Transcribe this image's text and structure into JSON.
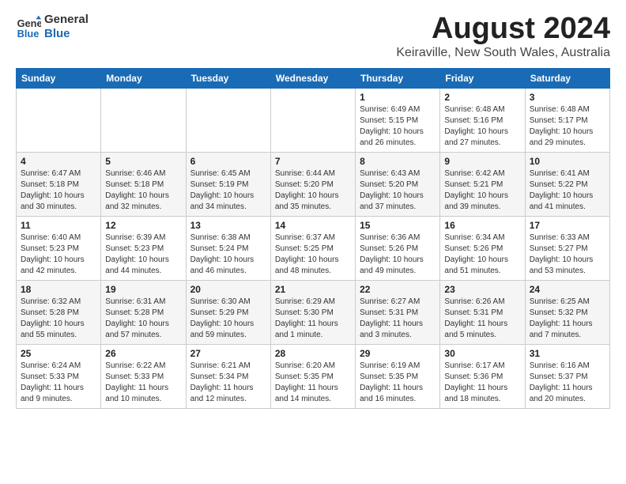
{
  "logo": {
    "line1": "General",
    "line2": "Blue"
  },
  "title": {
    "month_year": "August 2024",
    "location": "Keiraville, New South Wales, Australia"
  },
  "weekdays": [
    "Sunday",
    "Monday",
    "Tuesday",
    "Wednesday",
    "Thursday",
    "Friday",
    "Saturday"
  ],
  "weeks": [
    [
      {
        "day": "",
        "info": ""
      },
      {
        "day": "",
        "info": ""
      },
      {
        "day": "",
        "info": ""
      },
      {
        "day": "",
        "info": ""
      },
      {
        "day": "1",
        "info": "Sunrise: 6:49 AM\nSunset: 5:15 PM\nDaylight: 10 hours\nand 26 minutes."
      },
      {
        "day": "2",
        "info": "Sunrise: 6:48 AM\nSunset: 5:16 PM\nDaylight: 10 hours\nand 27 minutes."
      },
      {
        "day": "3",
        "info": "Sunrise: 6:48 AM\nSunset: 5:17 PM\nDaylight: 10 hours\nand 29 minutes."
      }
    ],
    [
      {
        "day": "4",
        "info": "Sunrise: 6:47 AM\nSunset: 5:18 PM\nDaylight: 10 hours\nand 30 minutes."
      },
      {
        "day": "5",
        "info": "Sunrise: 6:46 AM\nSunset: 5:18 PM\nDaylight: 10 hours\nand 32 minutes."
      },
      {
        "day": "6",
        "info": "Sunrise: 6:45 AM\nSunset: 5:19 PM\nDaylight: 10 hours\nand 34 minutes."
      },
      {
        "day": "7",
        "info": "Sunrise: 6:44 AM\nSunset: 5:20 PM\nDaylight: 10 hours\nand 35 minutes."
      },
      {
        "day": "8",
        "info": "Sunrise: 6:43 AM\nSunset: 5:20 PM\nDaylight: 10 hours\nand 37 minutes."
      },
      {
        "day": "9",
        "info": "Sunrise: 6:42 AM\nSunset: 5:21 PM\nDaylight: 10 hours\nand 39 minutes."
      },
      {
        "day": "10",
        "info": "Sunrise: 6:41 AM\nSunset: 5:22 PM\nDaylight: 10 hours\nand 41 minutes."
      }
    ],
    [
      {
        "day": "11",
        "info": "Sunrise: 6:40 AM\nSunset: 5:23 PM\nDaylight: 10 hours\nand 42 minutes."
      },
      {
        "day": "12",
        "info": "Sunrise: 6:39 AM\nSunset: 5:23 PM\nDaylight: 10 hours\nand 44 minutes."
      },
      {
        "day": "13",
        "info": "Sunrise: 6:38 AM\nSunset: 5:24 PM\nDaylight: 10 hours\nand 46 minutes."
      },
      {
        "day": "14",
        "info": "Sunrise: 6:37 AM\nSunset: 5:25 PM\nDaylight: 10 hours\nand 48 minutes."
      },
      {
        "day": "15",
        "info": "Sunrise: 6:36 AM\nSunset: 5:26 PM\nDaylight: 10 hours\nand 49 minutes."
      },
      {
        "day": "16",
        "info": "Sunrise: 6:34 AM\nSunset: 5:26 PM\nDaylight: 10 hours\nand 51 minutes."
      },
      {
        "day": "17",
        "info": "Sunrise: 6:33 AM\nSunset: 5:27 PM\nDaylight: 10 hours\nand 53 minutes."
      }
    ],
    [
      {
        "day": "18",
        "info": "Sunrise: 6:32 AM\nSunset: 5:28 PM\nDaylight: 10 hours\nand 55 minutes."
      },
      {
        "day": "19",
        "info": "Sunrise: 6:31 AM\nSunset: 5:28 PM\nDaylight: 10 hours\nand 57 minutes."
      },
      {
        "day": "20",
        "info": "Sunrise: 6:30 AM\nSunset: 5:29 PM\nDaylight: 10 hours\nand 59 minutes."
      },
      {
        "day": "21",
        "info": "Sunrise: 6:29 AM\nSunset: 5:30 PM\nDaylight: 11 hours\nand 1 minute."
      },
      {
        "day": "22",
        "info": "Sunrise: 6:27 AM\nSunset: 5:31 PM\nDaylight: 11 hours\nand 3 minutes."
      },
      {
        "day": "23",
        "info": "Sunrise: 6:26 AM\nSunset: 5:31 PM\nDaylight: 11 hours\nand 5 minutes."
      },
      {
        "day": "24",
        "info": "Sunrise: 6:25 AM\nSunset: 5:32 PM\nDaylight: 11 hours\nand 7 minutes."
      }
    ],
    [
      {
        "day": "25",
        "info": "Sunrise: 6:24 AM\nSunset: 5:33 PM\nDaylight: 11 hours\nand 9 minutes."
      },
      {
        "day": "26",
        "info": "Sunrise: 6:22 AM\nSunset: 5:33 PM\nDaylight: 11 hours\nand 10 minutes."
      },
      {
        "day": "27",
        "info": "Sunrise: 6:21 AM\nSunset: 5:34 PM\nDaylight: 11 hours\nand 12 minutes."
      },
      {
        "day": "28",
        "info": "Sunrise: 6:20 AM\nSunset: 5:35 PM\nDaylight: 11 hours\nand 14 minutes."
      },
      {
        "day": "29",
        "info": "Sunrise: 6:19 AM\nSunset: 5:35 PM\nDaylight: 11 hours\nand 16 minutes."
      },
      {
        "day": "30",
        "info": "Sunrise: 6:17 AM\nSunset: 5:36 PM\nDaylight: 11 hours\nand 18 minutes."
      },
      {
        "day": "31",
        "info": "Sunrise: 6:16 AM\nSunset: 5:37 PM\nDaylight: 11 hours\nand 20 minutes."
      }
    ]
  ]
}
